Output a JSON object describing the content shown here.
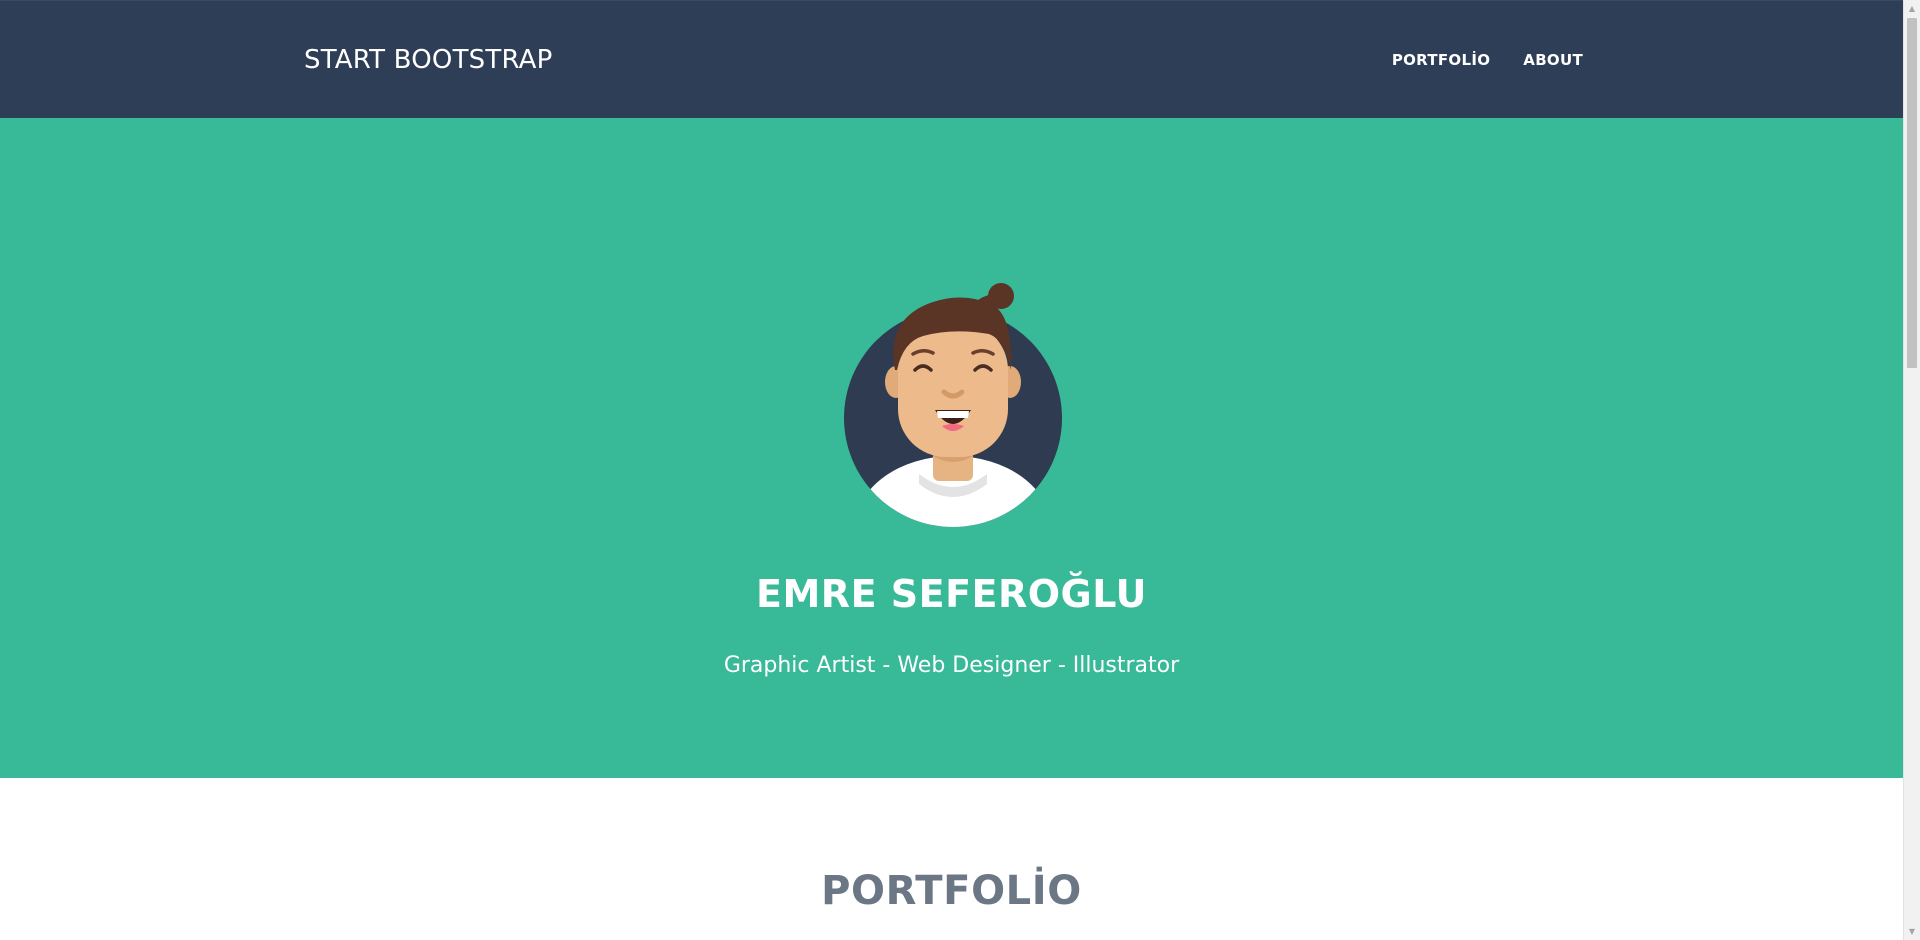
{
  "navbar": {
    "brand": "START BOOTSTRAP",
    "links": [
      {
        "label": "PORTFOLİO"
      },
      {
        "label": "ABOUT"
      }
    ]
  },
  "hero": {
    "avatar_icon": "avatar-illustration",
    "name": "EMRE SEFEROĞLU",
    "subtitle": "Graphic Artist - Web Designer - Illustrator"
  },
  "portfolio": {
    "heading": "PORTFOLİO"
  },
  "colors": {
    "navbar_bg": "#2f3e57",
    "hero_bg": "#38b997",
    "heading_gray": "#6b7785"
  },
  "scrollbar": {
    "up_icon": "scroll-up-arrow-icon",
    "down_icon": "scroll-down-arrow-icon"
  }
}
